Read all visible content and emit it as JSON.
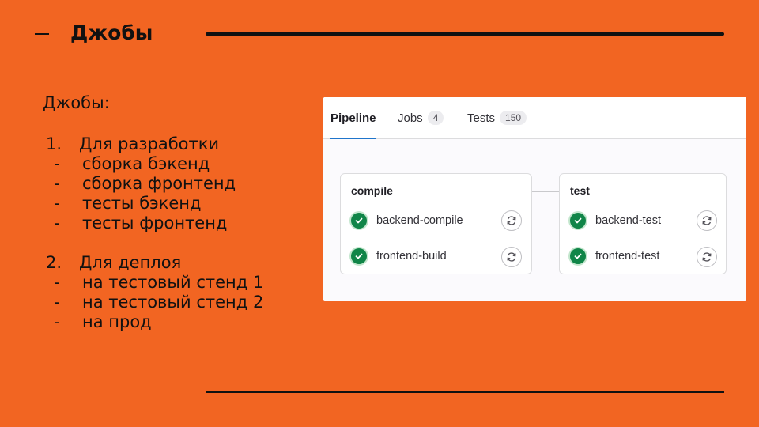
{
  "slide": {
    "title": "Джобы",
    "heading": "Джобы:",
    "groups": [
      {
        "num": "1.",
        "label": "Для разработки",
        "items": [
          "сборка бэкенд",
          "сборка фронтенд",
          "тесты бэкенд",
          "тесты фронтенд"
        ]
      },
      {
        "num": "2.",
        "label": "Для деплоя",
        "items": [
          "на тестовый стенд 1",
          "на тестовый стенд 2",
          "на прод"
        ]
      }
    ],
    "bullet": "-"
  },
  "pipeline": {
    "tabs": [
      {
        "label": "Pipeline",
        "count": null
      },
      {
        "label": "Jobs",
        "count": "4"
      },
      {
        "label": "Tests",
        "count": "150"
      }
    ],
    "stages": [
      {
        "name": "compile",
        "jobs": [
          "backend-compile",
          "frontend-build"
        ]
      },
      {
        "name": "test",
        "jobs": [
          "backend-test",
          "frontend-test"
        ]
      }
    ]
  },
  "colors": {
    "background": "#f26522",
    "success": "#108548",
    "tab_accent": "#1f75cb"
  },
  "icons": {
    "job_status": "check-circle-icon",
    "job_action": "retry-icon"
  }
}
